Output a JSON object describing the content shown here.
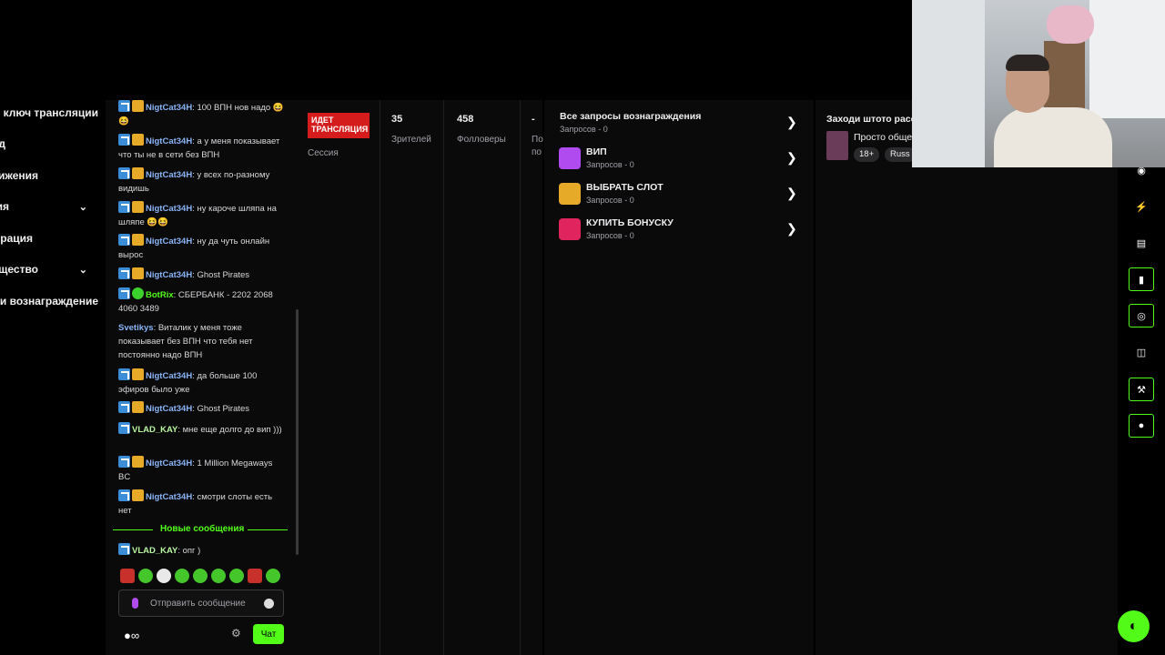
{
  "left_nav": {
    "items": [
      {
        "label": "ключ трансляции",
        "chevron": false
      },
      {
        "label": "д",
        "chevron": false
      },
      {
        "label": "ижения",
        "chevron": false
      },
      {
        "label": "ия",
        "chevron": true
      },
      {
        "label": "рация",
        "chevron": false
      },
      {
        "label": "щество",
        "chevron": true
      },
      {
        "label": "и вознаграждение",
        "chevron": false
      }
    ]
  },
  "chat": {
    "messages": [
      {
        "user": "NigtCat34H",
        "text": ": 100 ВПН нов надо 😆😆",
        "color": "#8ab4f8",
        "badges": [
          "blue",
          "gold"
        ]
      },
      {
        "user": "NigtCat34H",
        "text": ": а у меня показывает что ты не в сети без ВПН",
        "color": "#8ab4f8",
        "badges": [
          "blue",
          "gold"
        ]
      },
      {
        "user": "NigtCat34H",
        "text": ": у всех по-разному видишь",
        "color": "#8ab4f8",
        "badges": [
          "blue",
          "gold"
        ]
      },
      {
        "user": "NigtCat34H",
        "text": ": ну кароче шляпа на шляпе 😆😆",
        "color": "#8ab4f8",
        "badges": [
          "blue",
          "gold"
        ]
      },
      {
        "user": "NigtCat34H",
        "text": ": ну да чуть онлайн вырос",
        "color": "#8ab4f8",
        "badges": [
          "blue",
          "gold"
        ]
      },
      {
        "user": "NigtCat34H",
        "text": ": Ghost Pirates",
        "color": "#8ab4f8",
        "badges": [
          "blue",
          "gold"
        ]
      },
      {
        "user": "BotRix",
        "text": ": СБЕРБАНК - 2202 2068 4060 3489",
        "color": "#53fc18",
        "badges": [
          "blue",
          "green"
        ]
      },
      {
        "user": "Svetikys",
        "text": ": Виталик у меня тоже показывает без ВПН что тебя нет постоянно надо ВПН",
        "color": "#8ab4f8",
        "badges": []
      },
      {
        "user": "NigtCat34H",
        "text": ": да больше 100 эфиров было уже",
        "color": "#8ab4f8",
        "badges": [
          "blue",
          "gold"
        ]
      },
      {
        "user": "NigtCat34H",
        "text": ": Ghost Pirates",
        "color": "#8ab4f8",
        "badges": [
          "blue",
          "gold"
        ]
      },
      {
        "user": "VLAD_KAY",
        "text": ": мне еще долго до вип )))",
        "color": "#b9f5a0",
        "badges": [
          "blue"
        ]
      },
      {
        "user": "NigtCat34H",
        "text": ": 1 Million Megaways BC",
        "color": "#8ab4f8",
        "badges": [
          "blue",
          "gold"
        ]
      },
      {
        "user": "NigtCat34H",
        "text": ": смотри слоты есть нет",
        "color": "#8ab4f8",
        "badges": [
          "blue",
          "gold"
        ]
      }
    ],
    "new_messages_label": "Новые сообщения",
    "after_new": {
      "user": "VLAD_KAY",
      "text": ": опг )",
      "color": "#b9f5a0"
    },
    "input_placeholder": "Отправить сообщение",
    "viewers_symbol": "∞",
    "chat_button": "Чат"
  },
  "stats": {
    "live_badge": "ИДЕТ ТРАНСЛЯЦИЯ",
    "session_label": "Сессия",
    "viewers_value": "35",
    "viewers_label": "Зрителей",
    "followers_value": "458",
    "followers_label": "Фолловеры",
    "extra_value": "-",
    "extra_label_1": "По",
    "extra_label_2": "по"
  },
  "rewards": {
    "title": "Все запросы вознаграждения",
    "title_sub": "Запросов - 0",
    "items": [
      {
        "name": "ВИП",
        "count": "Запросов - 0",
        "color": "#b04bf0"
      },
      {
        "name": "ВЫБРАТЬ СЛОТ",
        "count": "Запросов - 0",
        "color": "#e6a928"
      },
      {
        "name": "КУПИТЬ БОНУСКУ",
        "count": "Запросов - 0",
        "color": "#e0245e"
      }
    ]
  },
  "info": {
    "title": "Заходи штото расс",
    "category": "Просто обще",
    "tags": [
      "18+",
      "Russ"
    ]
  },
  "accent_color": "#53fc18"
}
